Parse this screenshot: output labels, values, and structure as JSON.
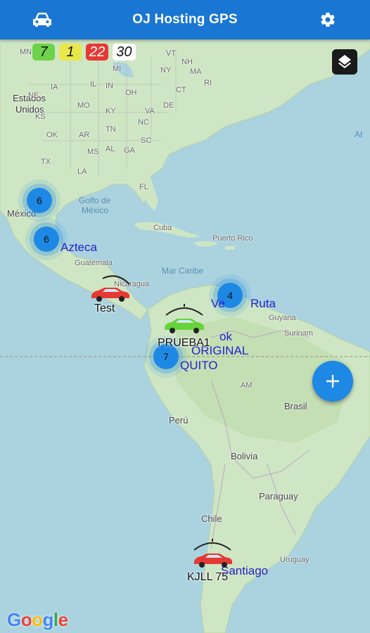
{
  "app": {
    "title": "OJ Hosting GPS"
  },
  "toolbar": {
    "left_icon": "car-icon",
    "right_icon": "gear-icon"
  },
  "counters": [
    {
      "value": "7",
      "color": "#6dd34a",
      "text_color": "#111"
    },
    {
      "value": "1",
      "color": "#e8e84a",
      "text_color": "#111"
    },
    {
      "value": "22",
      "color": "#e53935",
      "text_color": "#fff"
    },
    {
      "value": "30",
      "color": "#ffffff",
      "text_color": "#111"
    }
  ],
  "map_labels": {
    "estados": "Estados",
    "unidos": "Unidos",
    "golfo1": "Golfo de",
    "golfo2": "México",
    "mexico": "México",
    "cuba": "Cuba",
    "puerto_rico": "Puerto Rico",
    "mar_caribe": "Mar Caribe",
    "guatemala": "Guatemala",
    "nicaragua": "Nicaragua",
    "guyana": "Guyana",
    "surinam": "Surinam",
    "brasil": "Brasil",
    "peru": "Perú",
    "bolivia": "Bolivia",
    "paraguay": "Paraguay",
    "chile": "Chile",
    "uruguay": "Uruguay",
    "atl": "At",
    "am": "AM",
    "states": [
      "MN",
      "ME",
      "IA",
      "IL",
      "IN",
      "MI",
      "NY",
      "MO",
      "KY",
      "OH",
      "VT",
      "NH",
      "MA",
      "RI",
      "AR",
      "TN",
      "NC",
      "VA",
      "DE",
      "CT",
      "AL",
      "GA",
      "SC",
      "MS",
      "LA",
      "TX",
      "FL",
      "KS",
      "NE",
      "OK"
    ]
  },
  "clusters": [
    {
      "count": "6"
    },
    {
      "count": "6"
    },
    {
      "count": "4"
    },
    {
      "count": "7"
    }
  ],
  "vehicles": [
    {
      "label": "Test"
    },
    {
      "label": "PRUEBA1"
    },
    {
      "label": "KJLL 75"
    }
  ],
  "route_labels": {
    "azteca": "Azteca",
    "ruta": "Ruta",
    "ok": "ok",
    "original": "ORIGINAL",
    "quito": "QUITO",
    "santiago": "Santiago",
    "venez": "Ve"
  },
  "fab": {
    "icon": "plus-icon"
  },
  "layers": {
    "icon": "layers-icon"
  },
  "google_logo": "Google",
  "colors": {
    "appbar": "#1976d2",
    "water": "#aad3df",
    "land": "#cfe6c4",
    "cluster": "#1e88e5"
  }
}
